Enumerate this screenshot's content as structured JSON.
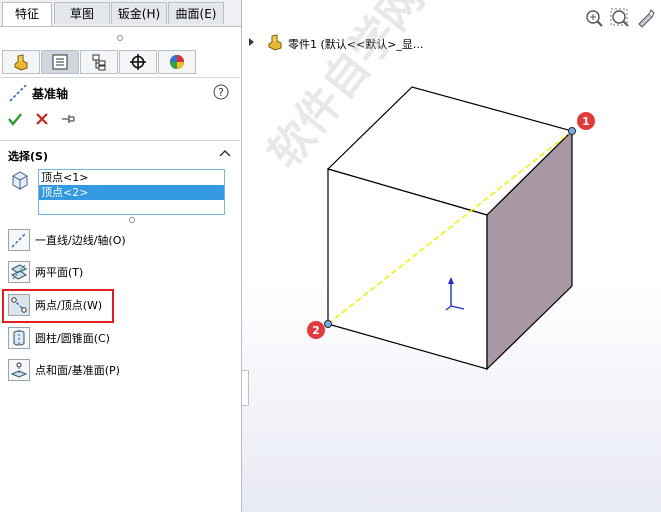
{
  "tabs": [
    {
      "label": "特征",
      "active": true
    },
    {
      "label": "草图",
      "active": false
    },
    {
      "label": "钣金(H)",
      "active": false
    },
    {
      "label": "曲面(E)",
      "active": false
    }
  ],
  "panel_icons": [
    "feature-manager-icon",
    "property-manager-icon",
    "configuration-manager-icon",
    "dimxpert-icon",
    "appearance-icon"
  ],
  "property_manager": {
    "title": "基准轴",
    "help_icon": "help-icon",
    "ok_icon": "check-icon",
    "cancel_icon": "close-icon",
    "pin_icon": "pin-icon"
  },
  "selection": {
    "header": "选择(S)",
    "items": [
      "顶点<1>",
      "顶点<2>"
    ],
    "selected_index": 1
  },
  "options": [
    {
      "label": "一直线/边线/轴(O)",
      "icon": "line-edge-axis-icon",
      "highlighted": false
    },
    {
      "label": "两平面(T)",
      "icon": "two-planes-icon",
      "highlighted": false
    },
    {
      "label": "两点/顶点(W)",
      "icon": "two-points-icon",
      "highlighted": true
    },
    {
      "label": "圆柱/圆锥面(C)",
      "icon": "cylinder-cone-icon",
      "highlighted": false
    },
    {
      "label": "点和面/基准面(P)",
      "icon": "point-plane-icon",
      "highlighted": false
    }
  ],
  "viewport": {
    "tree_label": "零件1 (默认<<默认>_显...",
    "view_icons": [
      "zoom-to-fit-icon",
      "zoom-area-icon",
      "previous-view-icon"
    ],
    "markers": [
      "1",
      "2"
    ],
    "watermark": "软件自学网 WWW.RJZXW.COM"
  },
  "colors": {
    "marker": "#e23b3b",
    "axis_line": "#f0f000",
    "cube_face_right": "#a898a4",
    "selection_bg": "#3399e0",
    "highlight_border": "#e02020"
  }
}
